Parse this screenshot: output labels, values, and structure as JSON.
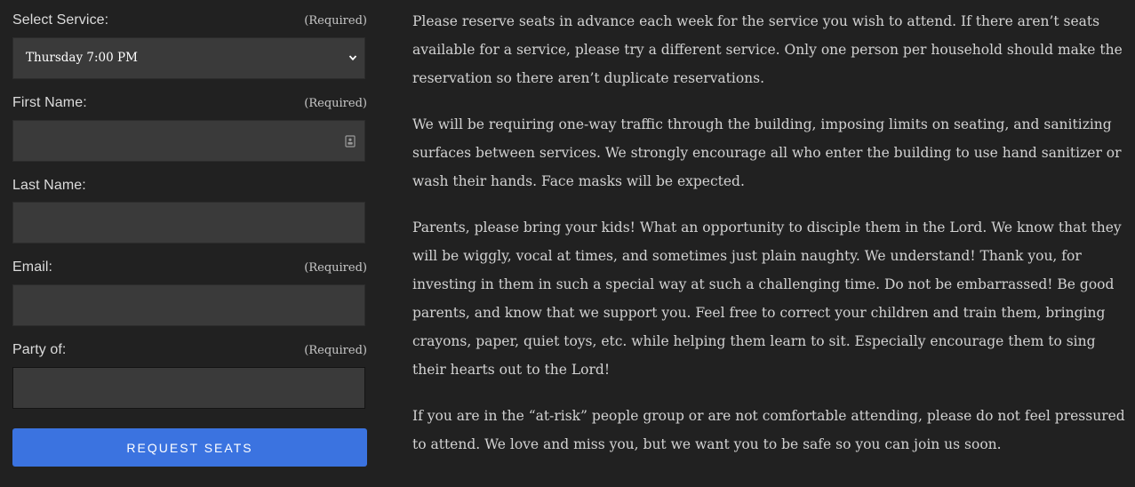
{
  "form": {
    "service": {
      "label": "Select Service:",
      "required": "(Required)",
      "selected": "Thursday 7:00 PM"
    },
    "first_name": {
      "label": "First Name:",
      "required": "(Required)",
      "value": ""
    },
    "last_name": {
      "label": "Last Name:",
      "value": ""
    },
    "email": {
      "label": "Email:",
      "required": "(Required)",
      "value": ""
    },
    "party": {
      "label": "Party of:",
      "required": "(Required)",
      "value": ""
    },
    "submit_label": "REQUEST SEATS"
  },
  "content": {
    "paragraphs": [
      "Please reserve seats in advance each week for the service you wish to attend. If there aren’t seats available for a service, please try a different service. Only one person per household should make the reservation so there aren’t duplicate reservations.",
      "We will be requiring one-way traffic through the building, imposing limits on seating, and sanitizing surfaces between services. We strongly encourage all who enter the building to use hand sanitizer or wash their hands. Face masks will be expected.",
      "Parents, please bring your kids! What an opportunity to disciple them in the Lord. We know that they will be wiggly, vocal at times, and sometimes just plain naughty. We understand! Thank you, for investing in them in such a special way at such a challenging time. Do not be embarrassed! Be good parents, and know that we support you. Feel free to correct your children and train them, bringing crayons, paper, quiet toys, etc. while helping them learn to sit. Especially encourage them to sing their hearts out to the Lord!",
      "If you are in the “at-risk” people group or are not comfortable attending, please do not feel pressured to attend. We love and miss you, but we want you to be safe so you can join us soon."
    ]
  },
  "colors": {
    "background": "#212121",
    "field_background": "#3a3a3a",
    "button": "#3b73e0"
  },
  "icons": {
    "select_chevron": "chevron-down-icon",
    "first_name_field": "contact-card-icon"
  }
}
